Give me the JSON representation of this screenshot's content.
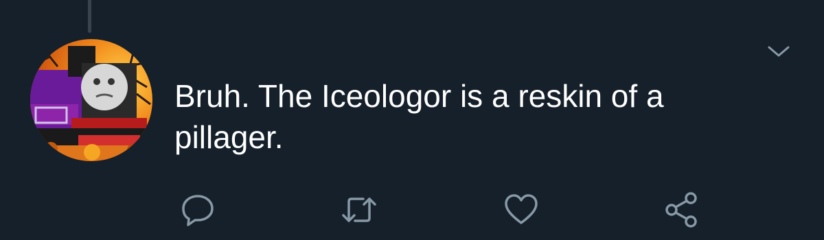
{
  "tweet": {
    "text": "Bruh. The Iceologor is a reskin of a pillager."
  },
  "icons": {
    "avatar": "profile-avatar-image",
    "caret": "chevron-down-icon",
    "reply": "reply-icon",
    "retweet": "retweet-icon",
    "like": "heart-icon",
    "share": "share-icon"
  },
  "colors": {
    "background": "#15202b",
    "text": "#ffffff",
    "icon": "#8899a6",
    "thread_line": "#38444d"
  }
}
